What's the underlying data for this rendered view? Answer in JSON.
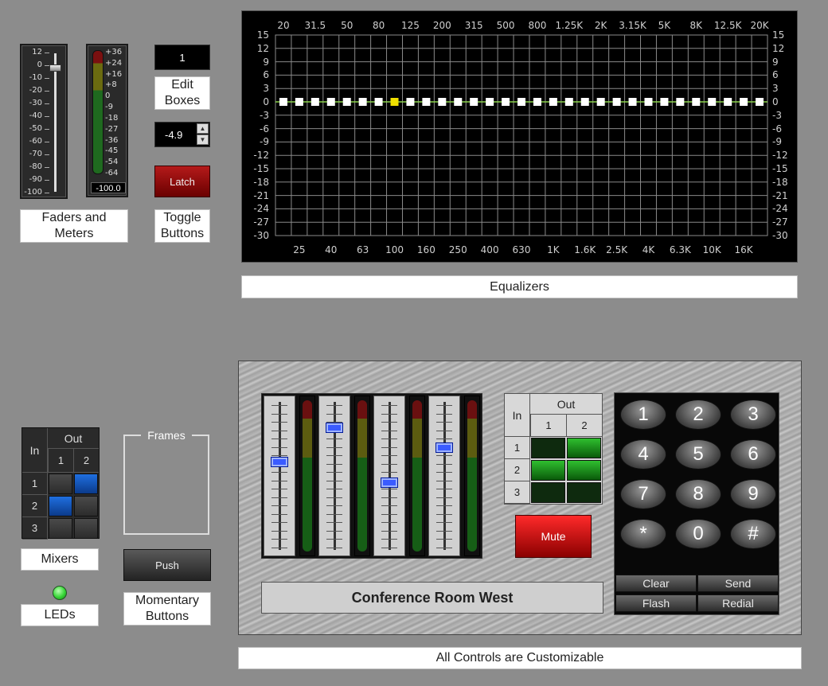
{
  "fader": {
    "scale": [
      "12",
      "0",
      "-10",
      "-20",
      "-30",
      "-40",
      "-50",
      "-60",
      "-70",
      "-80",
      "-90",
      "-100"
    ]
  },
  "meter": {
    "scale": [
      "+36",
      "+24",
      "+16",
      "+8",
      "0",
      "-9",
      "-18",
      "-27",
      "-36",
      "-45",
      "-54",
      "-64"
    ],
    "readout": "-100.0"
  },
  "faders_caption": [
    "Faders and",
    "Meters"
  ],
  "edit_box_value": "1",
  "edit_boxes_caption": [
    "Edit",
    "Boxes"
  ],
  "spin_value": "-4.9",
  "latch_label": "Latch",
  "toggle_caption": [
    "Toggle",
    "Buttons"
  ],
  "eq": {
    "top_freqs": [
      "20",
      "31.5",
      "50",
      "80",
      "125",
      "200",
      "315",
      "500",
      "800",
      "1.25K",
      "2K",
      "3.15K",
      "5K",
      "8K",
      "12.5K",
      "20K"
    ],
    "bottom_freqs": [
      "25",
      "40",
      "63",
      "100",
      "160",
      "250",
      "400",
      "630",
      "1K",
      "1.6K",
      "2.5K",
      "4K",
      "6.3K",
      "10K",
      "16K"
    ],
    "db_labels": [
      "15",
      "12",
      "9",
      "6",
      "3",
      "0",
      "-3",
      "-6",
      "-9",
      "-12",
      "-15",
      "-18",
      "-21",
      "-24",
      "-27",
      "-30"
    ],
    "band_count": 31,
    "selected_band": 7,
    "band_gain_db": 0,
    "colors": {
      "grid": "#8a8a8a",
      "zero_line": "#8ad24a",
      "band": "#ffffff",
      "selected": "#f0e000"
    }
  },
  "equalizers_caption": "Equalizers",
  "mixer": {
    "in_label": "In",
    "out_label": "Out",
    "out_cols": [
      "1",
      "2"
    ],
    "in_rows": [
      "1",
      "2",
      "3"
    ],
    "active": [
      [
        false,
        true
      ],
      [
        true,
        false
      ],
      [
        false,
        false
      ]
    ],
    "active_color": "#1f6fe0"
  },
  "mixers_caption": "Mixers",
  "frames_label": "Frames",
  "push_label": "Push",
  "momentary_caption": [
    "Momentary",
    "Buttons"
  ],
  "leds_caption": "LEDs",
  "led_color": "#36d636",
  "conference": {
    "fader_levels": [
      0.61,
      0.85,
      0.46,
      0.71
    ],
    "matrix": {
      "in_label": "In",
      "out_label": "Out",
      "out_cols": [
        "1",
        "2"
      ],
      "in_rows": [
        "1",
        "2",
        "3"
      ],
      "active": [
        [
          false,
          true
        ],
        [
          true,
          true
        ],
        [
          false,
          false
        ]
      ],
      "active_color": "#2fbf2f"
    },
    "mute_label": "Mute",
    "room_name": "Conference Room West",
    "keypad": [
      "1",
      "2",
      "3",
      "4",
      "5",
      "6",
      "7",
      "8",
      "9",
      "*",
      "0",
      "#"
    ],
    "functions": [
      "Clear",
      "Send",
      "Flash",
      "Redial"
    ]
  },
  "all_controls_caption": "All Controls are Customizable"
}
